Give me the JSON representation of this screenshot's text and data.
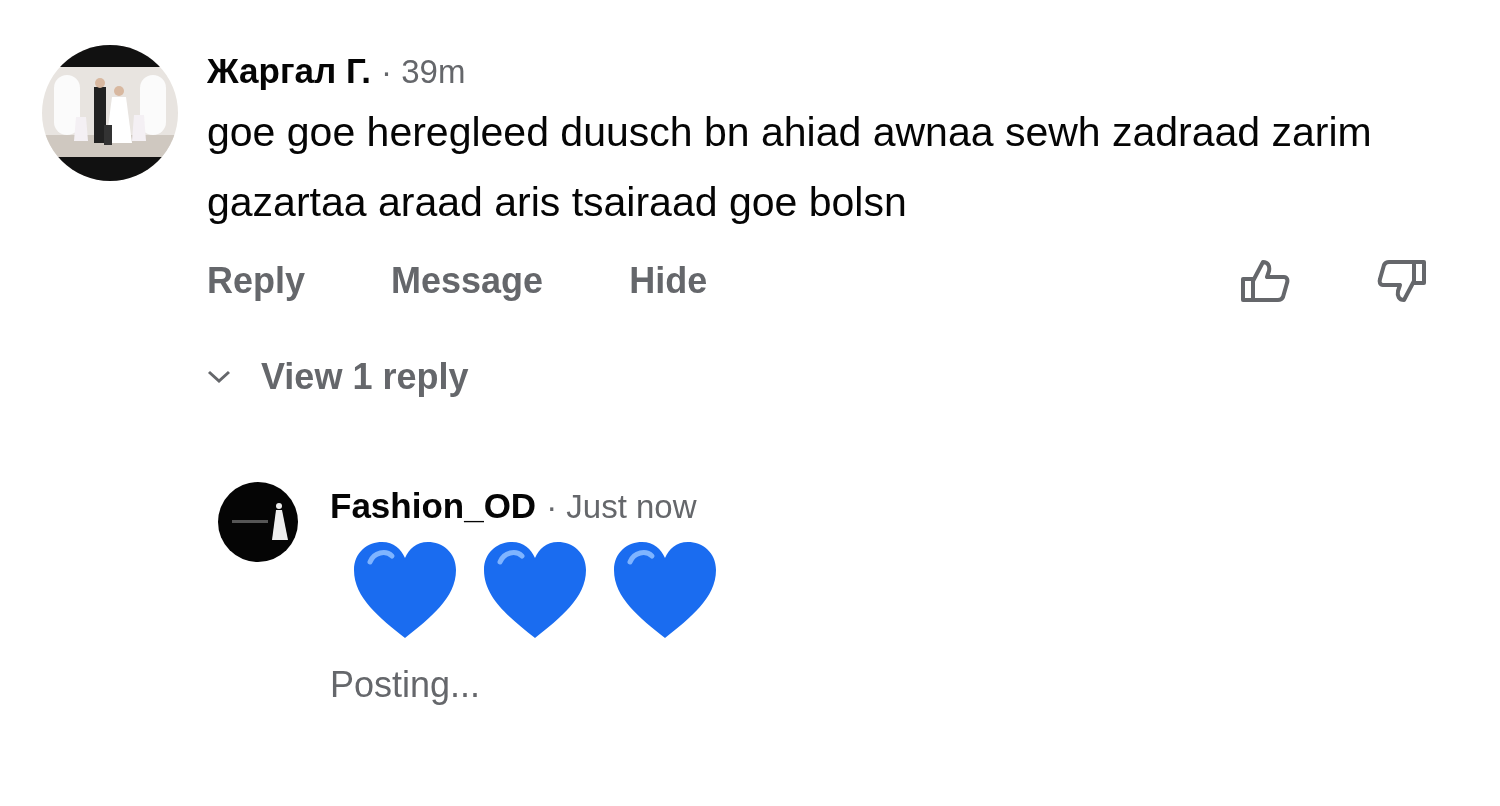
{
  "comment": {
    "author": "Жаргал Г.",
    "time": "· 39m",
    "text": "goe goe heregleed duusch bn ahiad awnaa sewh zadraad zarim gazartaa araad aris tsairaad goe bolsn",
    "actions": [
      "Reply",
      "Message",
      "Hide"
    ],
    "view_replies": "View 1 reply",
    "reply": {
      "author": "Fashion_OD",
      "time": "· Just now",
      "emoji": [
        {
          "kind": "blue-heart"
        },
        {
          "kind": "blue-heart"
        },
        {
          "kind": "blue-heart"
        }
      ],
      "status": "Posting..."
    }
  }
}
